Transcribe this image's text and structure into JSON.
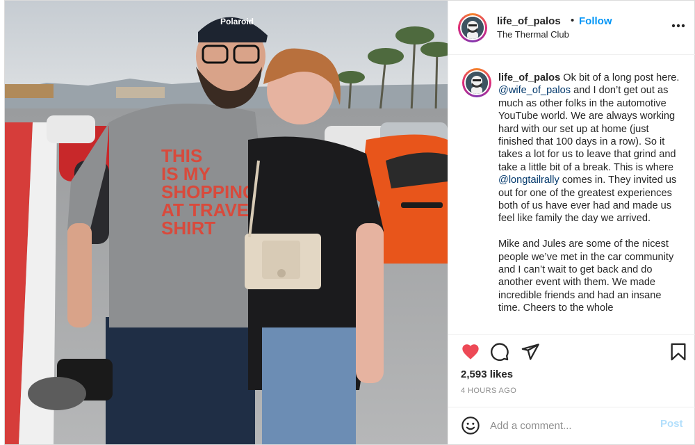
{
  "post": {
    "username": "life_of_palos",
    "separator": "•",
    "follow_label": "Follow",
    "location": "The Thermal Club",
    "more_icon": "more-options-icon",
    "media": {
      "description_icon": "photo",
      "cap_logo": "Polaroid",
      "shirt_lines": [
        "THIS",
        "IS MY",
        "SHOPPING",
        "AT TRAVEL",
        "SHIRT"
      ]
    },
    "caption": {
      "username": "life_of_palos",
      "p1_a": "Ok bit of a long post here. ",
      "mention1": "@wife_of_palos",
      "p1_b": " and I don’t get out as much as other folks in the automotive YouTube world. We are always working hard with our set up at home (just finished that 100 days in a row). So it takes a lot for us to leave that grind and take a little bit of a break. This is where ",
      "mention2": "@longtailrally",
      "p1_c": " comes in. They invited us out for one of the greatest experiences both of us have ever had and made us feel like family the day we arrived.",
      "p2": "Mike and Jules are some of the nicest people we’ve met in the car community and I can’t wait to get back and do another event with them. We made incredible friends and had an insane time. Cheers to the whole"
    },
    "actions": {
      "like_icon": "heart-filled-icon",
      "comment_icon": "comment-bubble-icon",
      "share_icon": "paper-plane-icon",
      "save_icon": "bookmark-icon",
      "like_color": "#ed4956"
    },
    "likes": "2,593 likes",
    "timestamp": "4 HOURS AGO",
    "comment": {
      "placeholder": "Add a comment...",
      "post_label": "Post"
    }
  },
  "colors": {
    "accent": "#0095f6",
    "post_disabled": "#b2dffc",
    "mention": "#00376b"
  }
}
